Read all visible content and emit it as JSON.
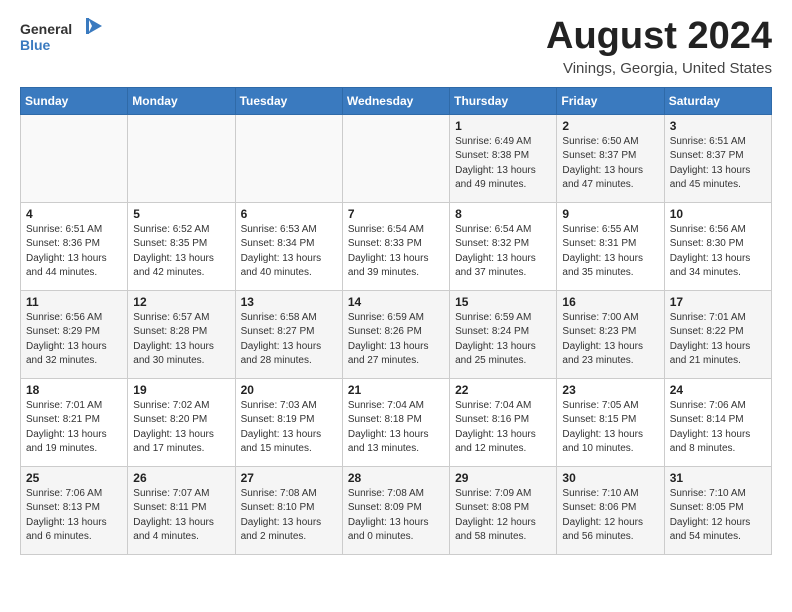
{
  "header": {
    "logo_general": "General",
    "logo_blue": "Blue",
    "month_year": "August 2024",
    "location": "Vinings, Georgia, United States"
  },
  "weekdays": [
    "Sunday",
    "Monday",
    "Tuesday",
    "Wednesday",
    "Thursday",
    "Friday",
    "Saturday"
  ],
  "weeks": [
    [
      {
        "day": "",
        "info": ""
      },
      {
        "day": "",
        "info": ""
      },
      {
        "day": "",
        "info": ""
      },
      {
        "day": "",
        "info": ""
      },
      {
        "day": "1",
        "info": "Sunrise: 6:49 AM\nSunset: 8:38 PM\nDaylight: 13 hours\nand 49 minutes."
      },
      {
        "day": "2",
        "info": "Sunrise: 6:50 AM\nSunset: 8:37 PM\nDaylight: 13 hours\nand 47 minutes."
      },
      {
        "day": "3",
        "info": "Sunrise: 6:51 AM\nSunset: 8:37 PM\nDaylight: 13 hours\nand 45 minutes."
      }
    ],
    [
      {
        "day": "4",
        "info": "Sunrise: 6:51 AM\nSunset: 8:36 PM\nDaylight: 13 hours\nand 44 minutes."
      },
      {
        "day": "5",
        "info": "Sunrise: 6:52 AM\nSunset: 8:35 PM\nDaylight: 13 hours\nand 42 minutes."
      },
      {
        "day": "6",
        "info": "Sunrise: 6:53 AM\nSunset: 8:34 PM\nDaylight: 13 hours\nand 40 minutes."
      },
      {
        "day": "7",
        "info": "Sunrise: 6:54 AM\nSunset: 8:33 PM\nDaylight: 13 hours\nand 39 minutes."
      },
      {
        "day": "8",
        "info": "Sunrise: 6:54 AM\nSunset: 8:32 PM\nDaylight: 13 hours\nand 37 minutes."
      },
      {
        "day": "9",
        "info": "Sunrise: 6:55 AM\nSunset: 8:31 PM\nDaylight: 13 hours\nand 35 minutes."
      },
      {
        "day": "10",
        "info": "Sunrise: 6:56 AM\nSunset: 8:30 PM\nDaylight: 13 hours\nand 34 minutes."
      }
    ],
    [
      {
        "day": "11",
        "info": "Sunrise: 6:56 AM\nSunset: 8:29 PM\nDaylight: 13 hours\nand 32 minutes."
      },
      {
        "day": "12",
        "info": "Sunrise: 6:57 AM\nSunset: 8:28 PM\nDaylight: 13 hours\nand 30 minutes."
      },
      {
        "day": "13",
        "info": "Sunrise: 6:58 AM\nSunset: 8:27 PM\nDaylight: 13 hours\nand 28 minutes."
      },
      {
        "day": "14",
        "info": "Sunrise: 6:59 AM\nSunset: 8:26 PM\nDaylight: 13 hours\nand 27 minutes."
      },
      {
        "day": "15",
        "info": "Sunrise: 6:59 AM\nSunset: 8:24 PM\nDaylight: 13 hours\nand 25 minutes."
      },
      {
        "day": "16",
        "info": "Sunrise: 7:00 AM\nSunset: 8:23 PM\nDaylight: 13 hours\nand 23 minutes."
      },
      {
        "day": "17",
        "info": "Sunrise: 7:01 AM\nSunset: 8:22 PM\nDaylight: 13 hours\nand 21 minutes."
      }
    ],
    [
      {
        "day": "18",
        "info": "Sunrise: 7:01 AM\nSunset: 8:21 PM\nDaylight: 13 hours\nand 19 minutes."
      },
      {
        "day": "19",
        "info": "Sunrise: 7:02 AM\nSunset: 8:20 PM\nDaylight: 13 hours\nand 17 minutes."
      },
      {
        "day": "20",
        "info": "Sunrise: 7:03 AM\nSunset: 8:19 PM\nDaylight: 13 hours\nand 15 minutes."
      },
      {
        "day": "21",
        "info": "Sunrise: 7:04 AM\nSunset: 8:18 PM\nDaylight: 13 hours\nand 13 minutes."
      },
      {
        "day": "22",
        "info": "Sunrise: 7:04 AM\nSunset: 8:16 PM\nDaylight: 13 hours\nand 12 minutes."
      },
      {
        "day": "23",
        "info": "Sunrise: 7:05 AM\nSunset: 8:15 PM\nDaylight: 13 hours\nand 10 minutes."
      },
      {
        "day": "24",
        "info": "Sunrise: 7:06 AM\nSunset: 8:14 PM\nDaylight: 13 hours\nand 8 minutes."
      }
    ],
    [
      {
        "day": "25",
        "info": "Sunrise: 7:06 AM\nSunset: 8:13 PM\nDaylight: 13 hours\nand 6 minutes."
      },
      {
        "day": "26",
        "info": "Sunrise: 7:07 AM\nSunset: 8:11 PM\nDaylight: 13 hours\nand 4 minutes."
      },
      {
        "day": "27",
        "info": "Sunrise: 7:08 AM\nSunset: 8:10 PM\nDaylight: 13 hours\nand 2 minutes."
      },
      {
        "day": "28",
        "info": "Sunrise: 7:08 AM\nSunset: 8:09 PM\nDaylight: 13 hours\nand 0 minutes."
      },
      {
        "day": "29",
        "info": "Sunrise: 7:09 AM\nSunset: 8:08 PM\nDaylight: 12 hours\nand 58 minutes."
      },
      {
        "day": "30",
        "info": "Sunrise: 7:10 AM\nSunset: 8:06 PM\nDaylight: 12 hours\nand 56 minutes."
      },
      {
        "day": "31",
        "info": "Sunrise: 7:10 AM\nSunset: 8:05 PM\nDaylight: 12 hours\nand 54 minutes."
      }
    ]
  ]
}
